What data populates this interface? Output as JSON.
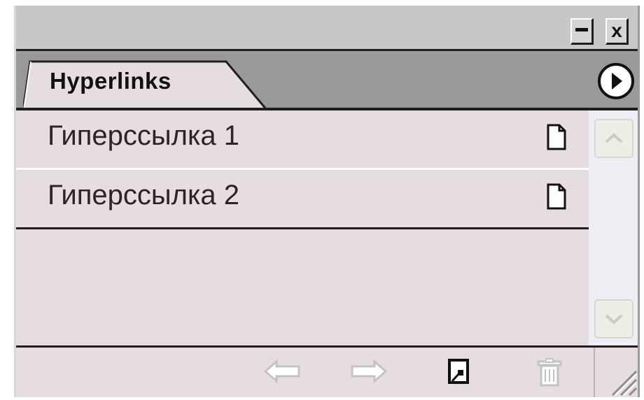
{
  "panel": {
    "tab_label": "Hyperlinks",
    "window_controls": {
      "minimize_icon": "minimize-icon",
      "close_icon": "close-icon",
      "close_glyph": "x"
    },
    "panel_menu_icon": "play-circle-icon"
  },
  "hyperlinks": [
    {
      "label": "Гиперссылка 1",
      "icon": "page-icon"
    },
    {
      "label": "Гиперссылка 2",
      "icon": "page-icon"
    }
  ],
  "scrollbar": {
    "up_icon": "chevron-up-icon",
    "down_icon": "chevron-down-icon"
  },
  "toolbar": {
    "buttons": [
      {
        "name": "go-to-source",
        "icon": "arrow-left-icon",
        "enabled": false
      },
      {
        "name": "go-to-destination",
        "icon": "arrow-right-icon",
        "enabled": false
      },
      {
        "name": "new-hyperlink",
        "icon": "new-item-icon",
        "enabled": true
      },
      {
        "name": "delete-hyperlink",
        "icon": "trash-icon",
        "enabled": false
      }
    ]
  },
  "colors": {
    "panel_bg": "#e6dde2",
    "tab_strip": "#9a9899",
    "titlebar": "#c9c6c8",
    "disabled_icon": "#c2c4c4"
  }
}
